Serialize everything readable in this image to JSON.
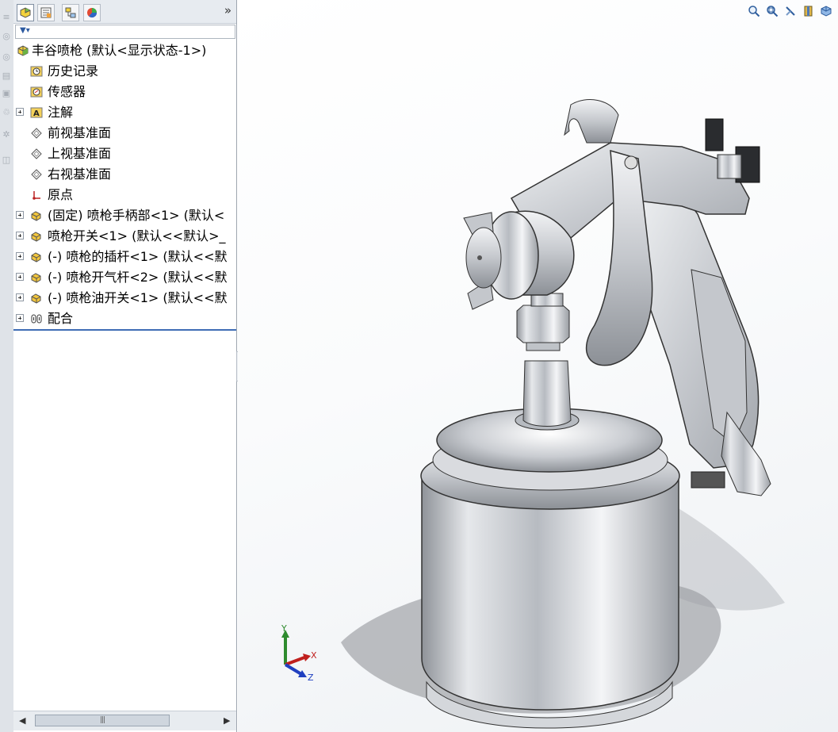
{
  "feature_manager": {
    "tabs": [
      {
        "name": "featuremanager-tab",
        "icon": "featuremanager-icon"
      },
      {
        "name": "propertymanager-tab",
        "icon": "propertymanager-icon"
      },
      {
        "name": "configurationmanager-tab",
        "icon": "configurationmanager-icon"
      },
      {
        "name": "displaymanager-tab",
        "icon": "displaymanager-icon"
      }
    ],
    "expand_label": "»",
    "tree": [
      {
        "label": "丰谷喷枪 (默认<显示状态-1>)",
        "icon": "assembly-icon",
        "expandable": false
      },
      {
        "label": "历史记录",
        "icon": "history-icon",
        "expandable": false
      },
      {
        "label": "传感器",
        "icon": "sensor-icon",
        "expandable": false
      },
      {
        "label": "注解",
        "icon": "annotation-icon",
        "expandable": true
      },
      {
        "label": "前视基准面",
        "icon": "plane-icon",
        "expandable": false
      },
      {
        "label": "上视基准面",
        "icon": "plane-icon",
        "expandable": false
      },
      {
        "label": "右视基准面",
        "icon": "plane-icon",
        "expandable": false
      },
      {
        "label": "原点",
        "icon": "origin-icon",
        "expandable": false
      },
      {
        "label": "(固定) 喷枪手柄部<1> (默认<",
        "icon": "part-icon",
        "expandable": true
      },
      {
        "label": "喷枪开关<1> (默认<<默认>_",
        "icon": "part-icon",
        "expandable": true
      },
      {
        "label": "(-) 喷枪的插杆<1> (默认<<默",
        "icon": "part-icon",
        "expandable": true
      },
      {
        "label": "(-) 喷枪开气杆<2> (默认<<默",
        "icon": "part-icon",
        "expandable": true
      },
      {
        "label": "(-) 喷枪油开关<1> (默认<<默",
        "icon": "part-icon",
        "expandable": true
      },
      {
        "label": "配合",
        "icon": "mates-icon",
        "expandable": true
      }
    ]
  },
  "triad": {
    "x": "X",
    "y": "Y",
    "z": "Z"
  },
  "colors": {
    "accent": "#3f6db5",
    "x_axis": "#c0201e",
    "y_axis": "#2e8b2e",
    "z_axis": "#2040c0"
  }
}
